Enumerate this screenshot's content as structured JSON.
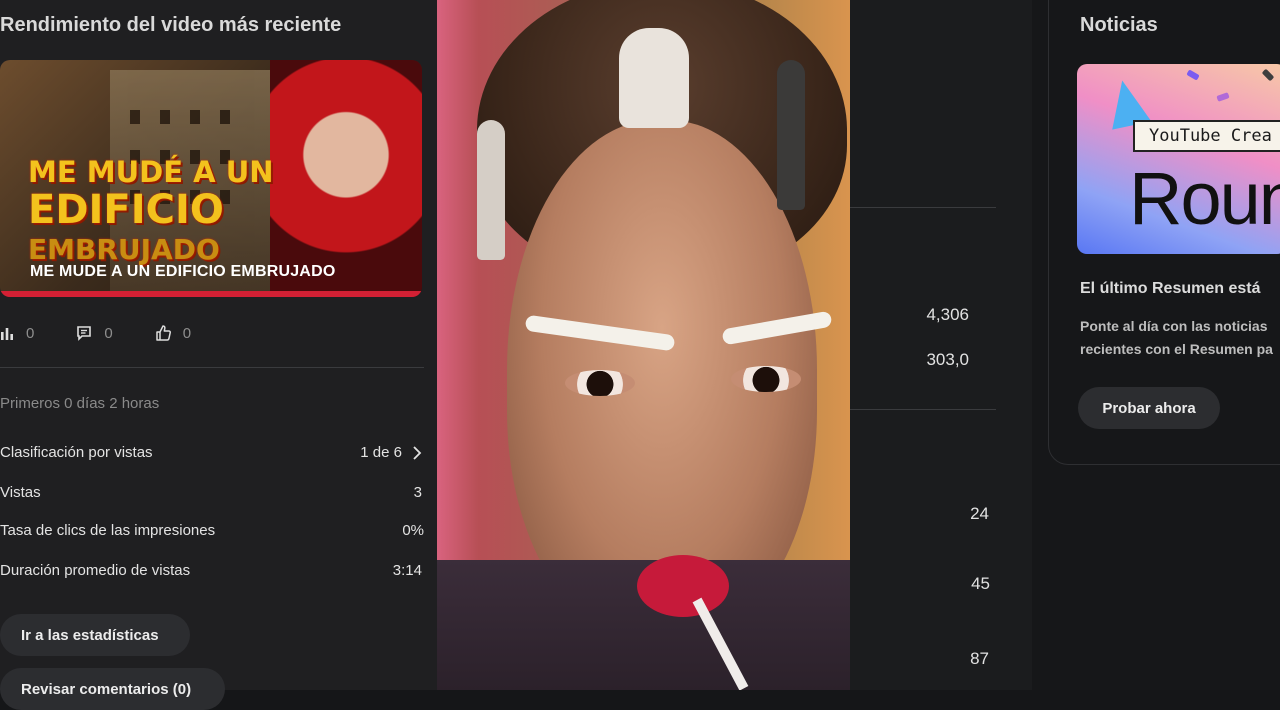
{
  "latest_video": {
    "section_title": "Rendimiento del video más reciente",
    "thumbnail_text": {
      "line1": "ME MUDÉ A UN",
      "line2": "EDIFICIO",
      "line3": "EMBRUJADO"
    },
    "video_title": "ME MUDE A UN EDIFICIO EMBRUJADO",
    "stats": {
      "views_count": "0",
      "comments_count": "0",
      "likes_count": "0"
    },
    "period_label": "Primeros 0 días 2  horas",
    "metrics": [
      {
        "label": "Clasificación por vistas",
        "value": "1 de 6"
      },
      {
        "label": "Vistas",
        "value": "3"
      },
      {
        "label": "Tasa de clics de las impresiones",
        "value": "0%"
      },
      {
        "label": "Duración promedio de vistas",
        "value": "3:14"
      }
    ],
    "go_to_analytics_label": "Ir a las estadísticas",
    "review_comments_label": "Revisar comentarios (0)"
  },
  "dashboard_numbers": {
    "n1": "4,306",
    "n2": "303,0",
    "n3": "24",
    "n4": "45",
    "n5": "87"
  },
  "news": {
    "section_title": "Noticias",
    "banner_tag": "YouTube Crea",
    "banner_big": "Roun",
    "headline": "El último Resumen está",
    "body": "Ponte al día con las noticias\nrecientes con el Resumen pa",
    "cta_label": "Probar ahora"
  },
  "colors": {
    "background": "#151618",
    "card": "#1f1f21",
    "pill": "#2c2d30",
    "accent_red": "#d32034"
  }
}
